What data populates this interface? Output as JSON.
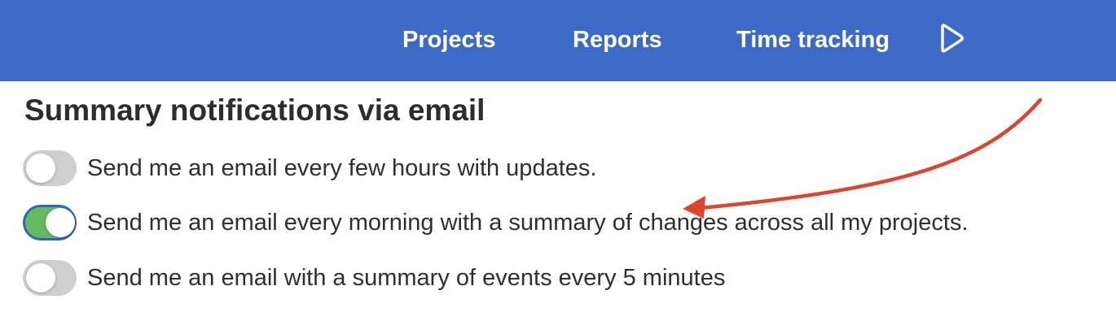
{
  "nav": {
    "items": [
      {
        "label": "Projects"
      },
      {
        "label": "Reports"
      },
      {
        "label": "Time tracking"
      }
    ],
    "play_icon": "play-icon"
  },
  "section": {
    "title": "Summary notifications via email"
  },
  "options": [
    {
      "label": "Send me an email every few hours with updates.",
      "enabled": false
    },
    {
      "label": "Send me an email every morning with a summary of changes across all my projects.",
      "enabled": true
    },
    {
      "label": "Send me an email with a summary of events every 5 minutes",
      "enabled": false
    }
  ],
  "colors": {
    "topbar": "#3d6ac8",
    "toggle_on": "#67b85f",
    "toggle_off": "#cfcfcf",
    "focus_ring": "#2f66c4",
    "annotation_arrow": "#e0432c"
  }
}
